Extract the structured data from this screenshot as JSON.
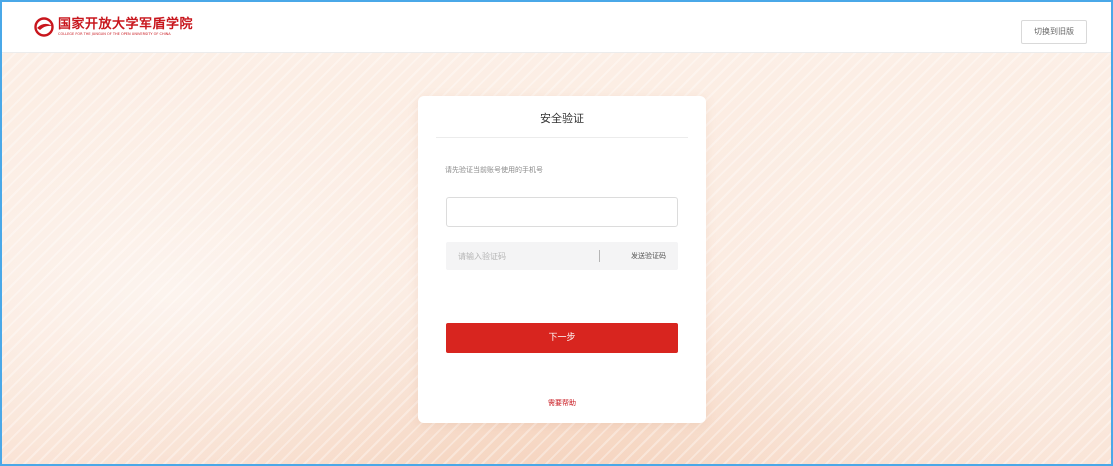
{
  "header": {
    "logo_cn": "国家开放大学军盾学院",
    "logo_en": "COLLEGE FOR THE JUNGUN OF THE OPEN UNIVERSITY OF CHINA",
    "switch_label": "切换到旧版"
  },
  "card": {
    "title": "安全验证",
    "hint": "请先验证当前账号使用的手机号",
    "phone": {
      "value": "",
      "placeholder": ""
    },
    "code": {
      "placeholder": "请输入验证码",
      "send_label": "发送验证码"
    },
    "next_label": "下一步",
    "help_label": "需要帮助"
  },
  "colors": {
    "brand_red": "#c8161d",
    "button_red": "#d8251f",
    "frame_blue": "#4aa8e8",
    "background": "#fbeadf"
  },
  "icons": {
    "logo": "college-emblem-icon"
  }
}
